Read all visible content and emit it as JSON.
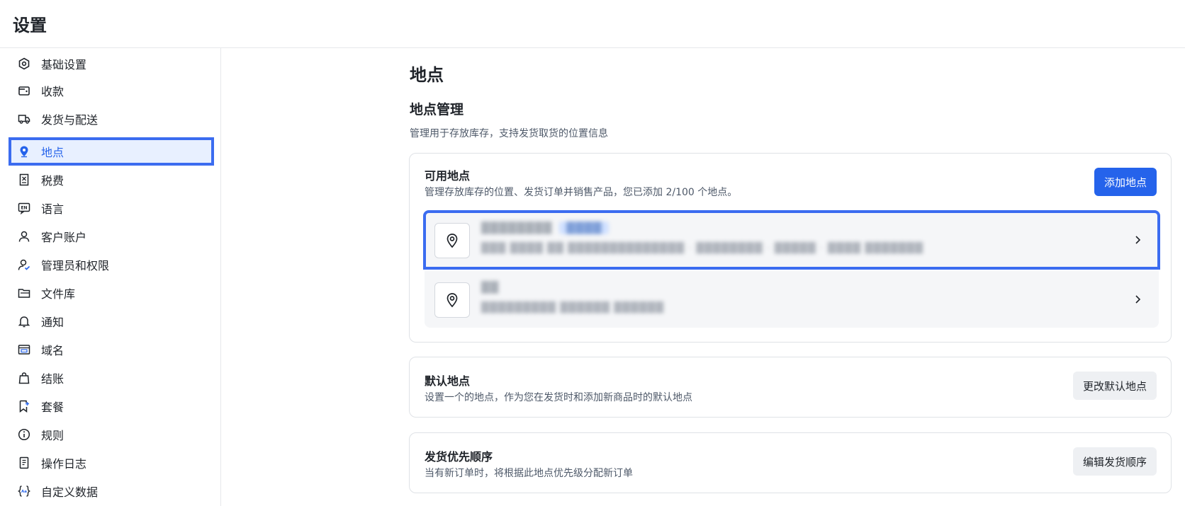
{
  "header": {
    "title": "设置"
  },
  "sidebar": {
    "items": [
      {
        "label": "基础设置",
        "icon": "hexagon-settings-icon"
      },
      {
        "label": "收款",
        "icon": "wallet-icon"
      },
      {
        "label": "发货与配送",
        "icon": "truck-icon"
      },
      {
        "label": "地点",
        "icon": "location-pin-icon",
        "active": true
      },
      {
        "label": "税费",
        "icon": "tax-receipt-icon"
      },
      {
        "label": "语言",
        "icon": "language-en-icon"
      },
      {
        "label": "客户账户",
        "icon": "user-icon"
      },
      {
        "label": "管理员和权限",
        "icon": "user-check-icon"
      },
      {
        "label": "文件库",
        "icon": "folder-icon"
      },
      {
        "label": "通知",
        "icon": "bell-icon"
      },
      {
        "label": "域名",
        "icon": "domain-icon"
      },
      {
        "label": "结账",
        "icon": "shopping-bag-icon"
      },
      {
        "label": "套餐",
        "icon": "bookmark-plus-icon"
      },
      {
        "label": "规则",
        "icon": "info-icon"
      },
      {
        "label": "操作日志",
        "icon": "log-document-icon"
      },
      {
        "label": "自定义数据",
        "icon": "braces-icon"
      }
    ]
  },
  "main": {
    "page_title": "地点",
    "section_title": "地点管理",
    "section_desc": "管理用于存放库存，支持发货取货的位置信息",
    "available": {
      "title": "可用地点",
      "desc": "管理存放库存的位置、发货订单并销售产品，您已添加 2/100 个地点。",
      "add_button": "添加地点",
      "locations": [
        {
          "name": "████████",
          "tag": "████",
          "address": "███ ████ ██ ██████████████ · ████████ · █████ · ████ ███████"
        },
        {
          "name": "██",
          "tag": "",
          "address": "█████████ ██████ ██████"
        }
      ]
    },
    "default_location": {
      "title": "默认地点",
      "desc": "设置一个的地点，作为您在发货时和添加新商品时的默认地点",
      "button": "更改默认地点"
    },
    "shipping_priority": {
      "title": "发货优先顺序",
      "desc": "当有新订单时，将根据此地点优先级分配新订单",
      "button": "编辑发货顺序"
    }
  },
  "colors": {
    "accent": "#2563eb",
    "highlight": "#3b6cf0"
  }
}
